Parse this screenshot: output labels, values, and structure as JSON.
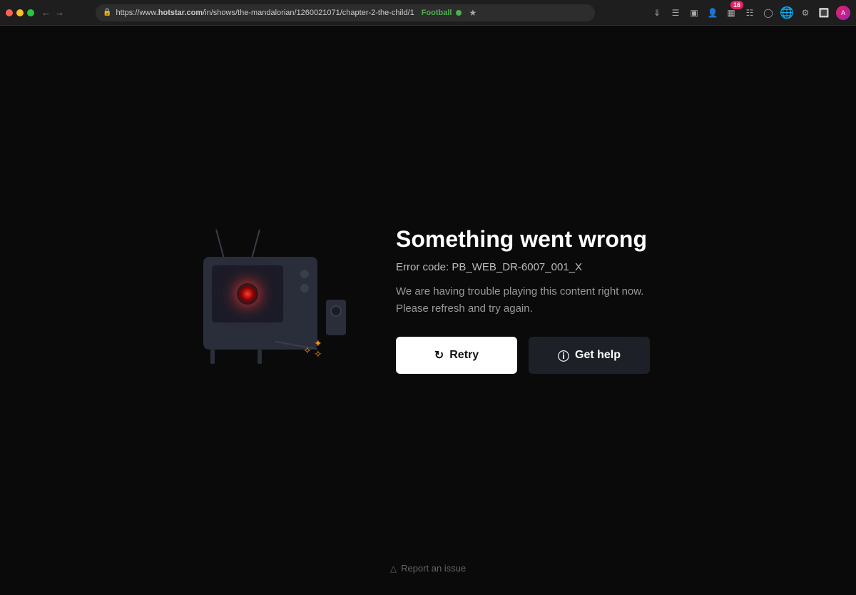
{
  "browser": {
    "url": "https://www.hotstar.com/in/shows/the-mandalorian/1260021071/chapter-2-the-child/1",
    "tab_label": "Football",
    "tab_dot_color": "#4caf50",
    "tab_badge": "16"
  },
  "error": {
    "title": "Something went wrong",
    "error_code_label": "Error code: PB_WEB_DR-6007_001_X",
    "description": "We are having trouble playing this content right now. Please refresh and try again.",
    "retry_button": "Retry",
    "get_help_button": "Get help",
    "report_issue_label": "Report an issue"
  }
}
